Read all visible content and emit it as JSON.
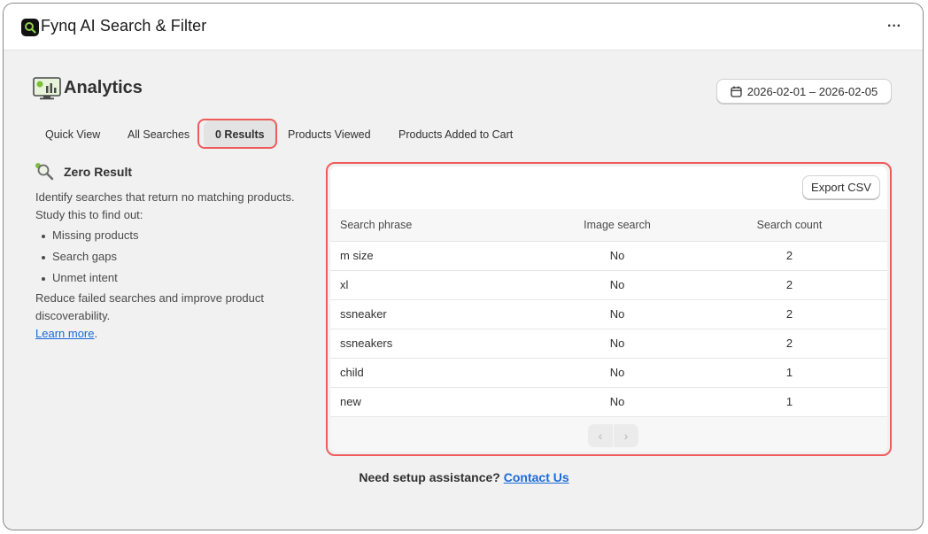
{
  "app": {
    "title": "Fynq AI Search & Filter",
    "more_label": "···"
  },
  "page": {
    "title": "Analytics",
    "date_range": "2026-02-01 – 2026-02-05"
  },
  "tabs": [
    {
      "label": "Quick View"
    },
    {
      "label": "All Searches"
    },
    {
      "label": "0 Results",
      "active": true
    },
    {
      "label": "Products Viewed"
    },
    {
      "label": "Products Added to Cart"
    }
  ],
  "info": {
    "title": "Zero Result",
    "line1": "Identify searches that return no matching products.",
    "line2": "Study this to find out:",
    "bullets": [
      "Missing products",
      "Search gaps",
      "Unmet intent"
    ],
    "line3": "Reduce failed searches and improve product discoverability.",
    "link": "Learn more",
    "link_suffix": "."
  },
  "table": {
    "export_label": "Export CSV",
    "headers": [
      "Search phrase",
      "Image search",
      "Search count"
    ],
    "rows": [
      [
        "m size",
        "No",
        "2"
      ],
      [
        "xl",
        "No",
        "2"
      ],
      [
        "ssneaker",
        "No",
        "2"
      ],
      [
        "ssneakers",
        "No",
        "2"
      ],
      [
        "child",
        "No",
        "1"
      ],
      [
        "new",
        "No",
        "1"
      ]
    ],
    "prev_label": "‹",
    "next_label": "›"
  },
  "footer": {
    "text": "Need setup assistance?",
    "link": "Contact Us"
  },
  "colors": {
    "highlight": "#ef5b5b",
    "link": "#1a6ad9",
    "accent_green": "#7cc03a"
  }
}
